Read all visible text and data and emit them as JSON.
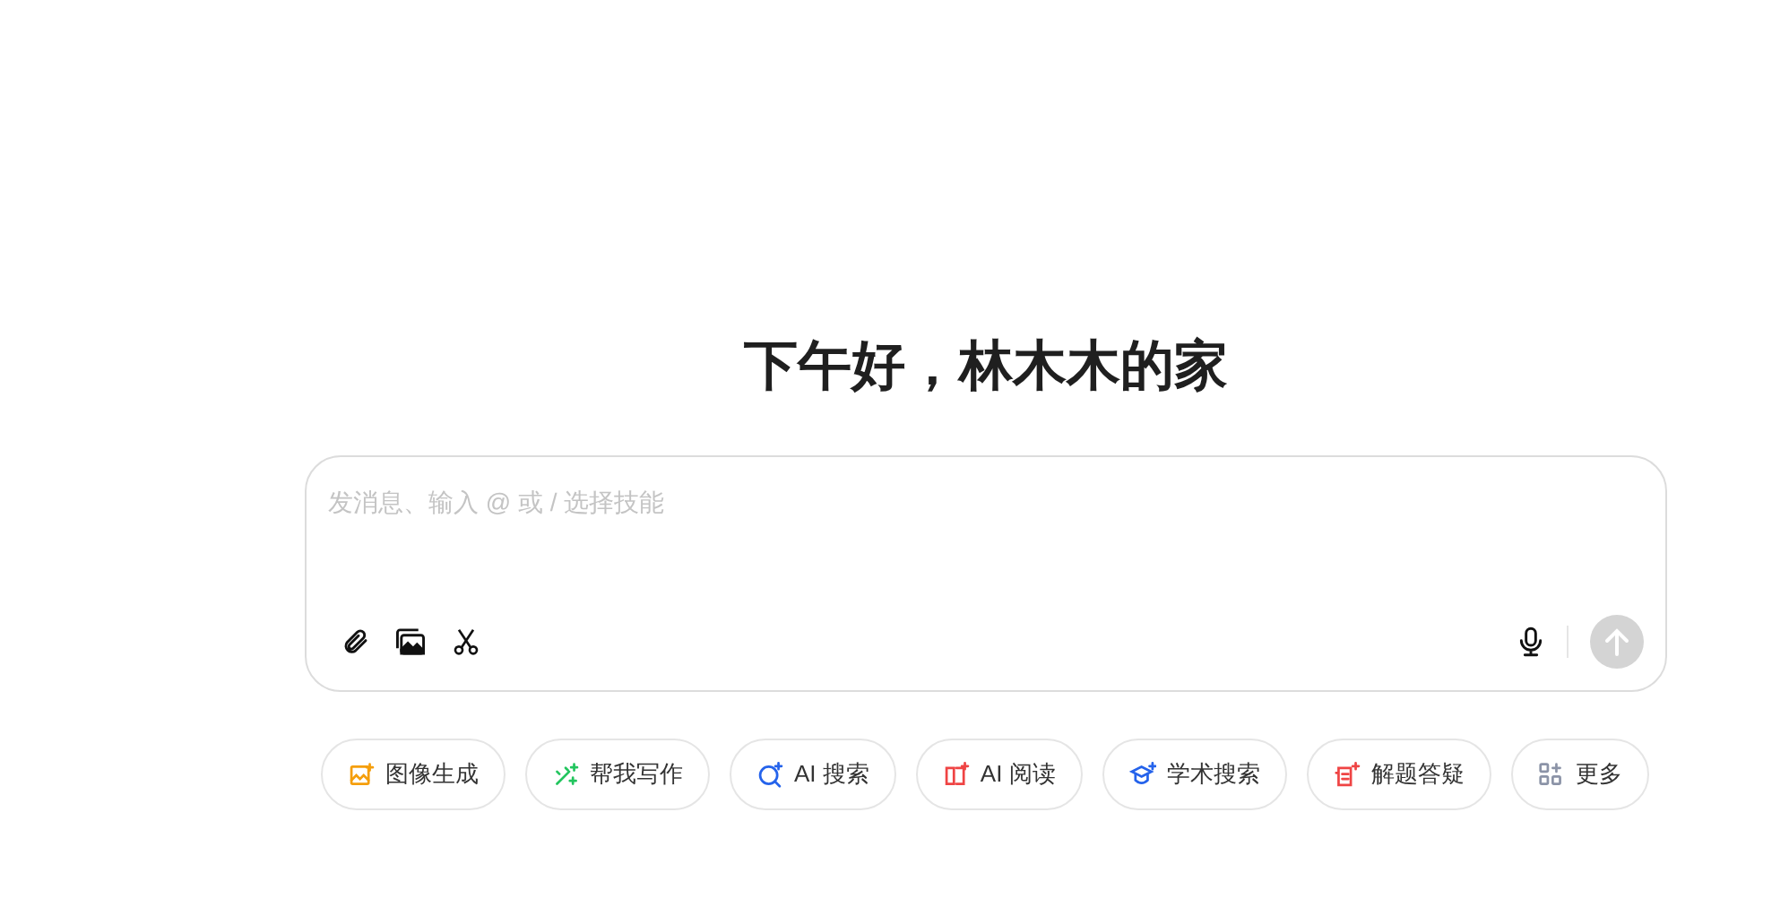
{
  "greeting": "下午好，林木木的家",
  "composer": {
    "placeholder": "发消息、输入 @ 或 / 选择技能",
    "send_disabled": true
  },
  "skills": [
    {
      "label": "图像生成",
      "kind": "image",
      "color": "#f59e0b"
    },
    {
      "label": "帮我写作",
      "kind": "write",
      "color": "#22c55e"
    },
    {
      "label": "AI 搜索",
      "kind": "search",
      "color": "#2563eb"
    },
    {
      "label": "AI 阅读",
      "kind": "read",
      "color": "#ef4444"
    },
    {
      "label": "学术搜索",
      "kind": "academic",
      "color": "#2563eb"
    },
    {
      "label": "解题答疑",
      "kind": "solve",
      "color": "#ef4444"
    },
    {
      "label": "更多",
      "kind": "more",
      "color": "#8b93a7"
    }
  ]
}
